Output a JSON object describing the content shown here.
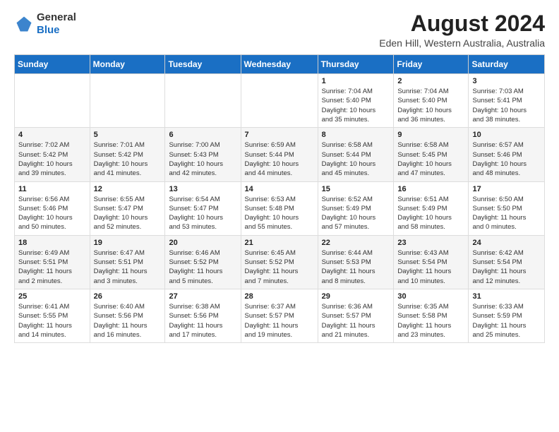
{
  "logo": {
    "general": "General",
    "blue": "Blue"
  },
  "title": "August 2024",
  "location": "Eden Hill, Western Australia, Australia",
  "headers": [
    "Sunday",
    "Monday",
    "Tuesday",
    "Wednesday",
    "Thursday",
    "Friday",
    "Saturday"
  ],
  "weeks": [
    [
      {
        "day": "",
        "info": ""
      },
      {
        "day": "",
        "info": ""
      },
      {
        "day": "",
        "info": ""
      },
      {
        "day": "",
        "info": ""
      },
      {
        "day": "1",
        "info": "Sunrise: 7:04 AM\nSunset: 5:40 PM\nDaylight: 10 hours\nand 35 minutes."
      },
      {
        "day": "2",
        "info": "Sunrise: 7:04 AM\nSunset: 5:40 PM\nDaylight: 10 hours\nand 36 minutes."
      },
      {
        "day": "3",
        "info": "Sunrise: 7:03 AM\nSunset: 5:41 PM\nDaylight: 10 hours\nand 38 minutes."
      }
    ],
    [
      {
        "day": "4",
        "info": "Sunrise: 7:02 AM\nSunset: 5:42 PM\nDaylight: 10 hours\nand 39 minutes."
      },
      {
        "day": "5",
        "info": "Sunrise: 7:01 AM\nSunset: 5:42 PM\nDaylight: 10 hours\nand 41 minutes."
      },
      {
        "day": "6",
        "info": "Sunrise: 7:00 AM\nSunset: 5:43 PM\nDaylight: 10 hours\nand 42 minutes."
      },
      {
        "day": "7",
        "info": "Sunrise: 6:59 AM\nSunset: 5:44 PM\nDaylight: 10 hours\nand 44 minutes."
      },
      {
        "day": "8",
        "info": "Sunrise: 6:58 AM\nSunset: 5:44 PM\nDaylight: 10 hours\nand 45 minutes."
      },
      {
        "day": "9",
        "info": "Sunrise: 6:58 AM\nSunset: 5:45 PM\nDaylight: 10 hours\nand 47 minutes."
      },
      {
        "day": "10",
        "info": "Sunrise: 6:57 AM\nSunset: 5:46 PM\nDaylight: 10 hours\nand 48 minutes."
      }
    ],
    [
      {
        "day": "11",
        "info": "Sunrise: 6:56 AM\nSunset: 5:46 PM\nDaylight: 10 hours\nand 50 minutes."
      },
      {
        "day": "12",
        "info": "Sunrise: 6:55 AM\nSunset: 5:47 PM\nDaylight: 10 hours\nand 52 minutes."
      },
      {
        "day": "13",
        "info": "Sunrise: 6:54 AM\nSunset: 5:47 PM\nDaylight: 10 hours\nand 53 minutes."
      },
      {
        "day": "14",
        "info": "Sunrise: 6:53 AM\nSunset: 5:48 PM\nDaylight: 10 hours\nand 55 minutes."
      },
      {
        "day": "15",
        "info": "Sunrise: 6:52 AM\nSunset: 5:49 PM\nDaylight: 10 hours\nand 57 minutes."
      },
      {
        "day": "16",
        "info": "Sunrise: 6:51 AM\nSunset: 5:49 PM\nDaylight: 10 hours\nand 58 minutes."
      },
      {
        "day": "17",
        "info": "Sunrise: 6:50 AM\nSunset: 5:50 PM\nDaylight: 11 hours\nand 0 minutes."
      }
    ],
    [
      {
        "day": "18",
        "info": "Sunrise: 6:49 AM\nSunset: 5:51 PM\nDaylight: 11 hours\nand 2 minutes."
      },
      {
        "day": "19",
        "info": "Sunrise: 6:47 AM\nSunset: 5:51 PM\nDaylight: 11 hours\nand 3 minutes."
      },
      {
        "day": "20",
        "info": "Sunrise: 6:46 AM\nSunset: 5:52 PM\nDaylight: 11 hours\nand 5 minutes."
      },
      {
        "day": "21",
        "info": "Sunrise: 6:45 AM\nSunset: 5:52 PM\nDaylight: 11 hours\nand 7 minutes."
      },
      {
        "day": "22",
        "info": "Sunrise: 6:44 AM\nSunset: 5:53 PM\nDaylight: 11 hours\nand 8 minutes."
      },
      {
        "day": "23",
        "info": "Sunrise: 6:43 AM\nSunset: 5:54 PM\nDaylight: 11 hours\nand 10 minutes."
      },
      {
        "day": "24",
        "info": "Sunrise: 6:42 AM\nSunset: 5:54 PM\nDaylight: 11 hours\nand 12 minutes."
      }
    ],
    [
      {
        "day": "25",
        "info": "Sunrise: 6:41 AM\nSunset: 5:55 PM\nDaylight: 11 hours\nand 14 minutes."
      },
      {
        "day": "26",
        "info": "Sunrise: 6:40 AM\nSunset: 5:56 PM\nDaylight: 11 hours\nand 16 minutes."
      },
      {
        "day": "27",
        "info": "Sunrise: 6:38 AM\nSunset: 5:56 PM\nDaylight: 11 hours\nand 17 minutes."
      },
      {
        "day": "28",
        "info": "Sunrise: 6:37 AM\nSunset: 5:57 PM\nDaylight: 11 hours\nand 19 minutes."
      },
      {
        "day": "29",
        "info": "Sunrise: 6:36 AM\nSunset: 5:57 PM\nDaylight: 11 hours\nand 21 minutes."
      },
      {
        "day": "30",
        "info": "Sunrise: 6:35 AM\nSunset: 5:58 PM\nDaylight: 11 hours\nand 23 minutes."
      },
      {
        "day": "31",
        "info": "Sunrise: 6:33 AM\nSunset: 5:59 PM\nDaylight: 11 hours\nand 25 minutes."
      }
    ]
  ]
}
